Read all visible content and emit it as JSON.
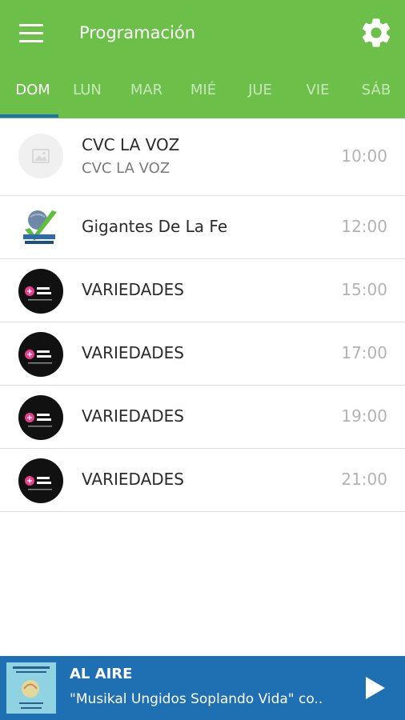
{
  "header": {
    "title": "Programación",
    "menu_icon": "menu-icon",
    "settings_icon": "gear-icon",
    "background": "#6cc04a"
  },
  "tabs": [
    {
      "label": "DOM",
      "active": true
    },
    {
      "label": "LUN",
      "active": false
    },
    {
      "label": "MAR",
      "active": false
    },
    {
      "label": "MIÉ",
      "active": false
    },
    {
      "label": "JUE",
      "active": false
    },
    {
      "label": "VIE",
      "active": false
    },
    {
      "label": "SÁB",
      "active": false
    }
  ],
  "schedule": [
    {
      "name": "CVC LA VOZ",
      "subtitle": "CVC LA VOZ",
      "time": "10:00",
      "thumb": "image-placeholder-icon"
    },
    {
      "name": "Gigantes De La Fe",
      "subtitle": "",
      "time": "12:00",
      "thumb": "gigantes-logo"
    },
    {
      "name": "VARIEDADES",
      "subtitle": "",
      "time": "15:00",
      "thumb": "radio-ungidos-logo"
    },
    {
      "name": "VARIEDADES",
      "subtitle": "",
      "time": "17:00",
      "thumb": "radio-ungidos-logo"
    },
    {
      "name": "VARIEDADES",
      "subtitle": "",
      "time": "19:00",
      "thumb": "radio-ungidos-logo"
    },
    {
      "name": "VARIEDADES",
      "subtitle": "",
      "time": "21:00",
      "thumb": "radio-ungidos-logo"
    }
  ],
  "player": {
    "status": "AL AIRE",
    "now_playing": "\"Musikal Ungidos Soplando Vida\" co..",
    "play_icon": "play-icon",
    "background": "#1f6fb3"
  },
  "accent_indicator": "#1f6fb3"
}
